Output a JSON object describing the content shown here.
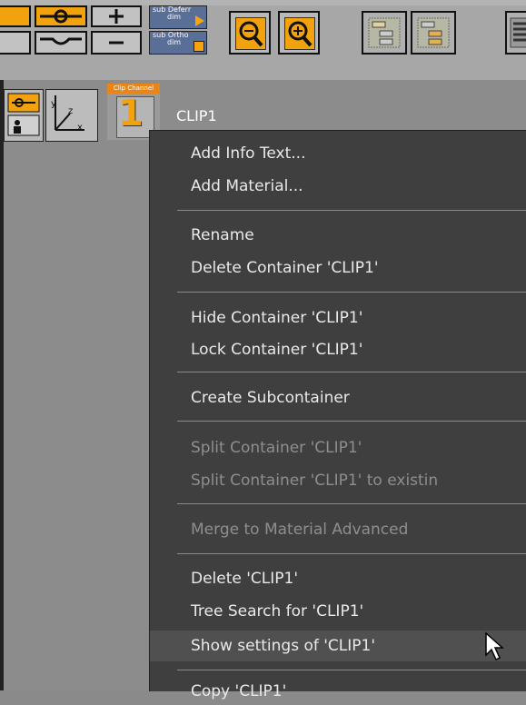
{
  "toolbar": {
    "sub_deferred": {
      "line1": "sub Deferr",
      "line2": "dim"
    },
    "sub_ortho": {
      "line1": "sub Ortho",
      "line2": "dim"
    }
  },
  "container": {
    "clip_channel_label": "Clip Channel",
    "clip_channel_number": "1",
    "axis_labels": {
      "y": "y",
      "z": "z",
      "x": "x"
    },
    "name": "CLIP1"
  },
  "menu": {
    "items": [
      {
        "label": "Add Info Text...",
        "enabled": true
      },
      {
        "label": "Add Material...",
        "enabled": true
      },
      {
        "label": "Rename",
        "enabled": true
      },
      {
        "label": "Delete Container 'CLIP1'",
        "enabled": true
      },
      {
        "label": "Hide Container 'CLIP1'",
        "enabled": true
      },
      {
        "label": "Lock Container 'CLIP1'",
        "enabled": true
      },
      {
        "label": "Create Subcontainer",
        "enabled": true
      },
      {
        "label": "Split Container 'CLIP1'",
        "enabled": false
      },
      {
        "label": "Split Container 'CLIP1' to existin",
        "enabled": false
      },
      {
        "label": "Merge to Material Advanced",
        "enabled": false
      },
      {
        "label": "Delete 'CLIP1'",
        "enabled": true
      },
      {
        "label": "Tree Search for 'CLIP1'",
        "enabled": true
      },
      {
        "label": "Show settings of 'CLIP1'",
        "enabled": true,
        "highlighted": true
      },
      {
        "label": "Copy 'CLIP1'",
        "enabled": true
      }
    ]
  }
}
